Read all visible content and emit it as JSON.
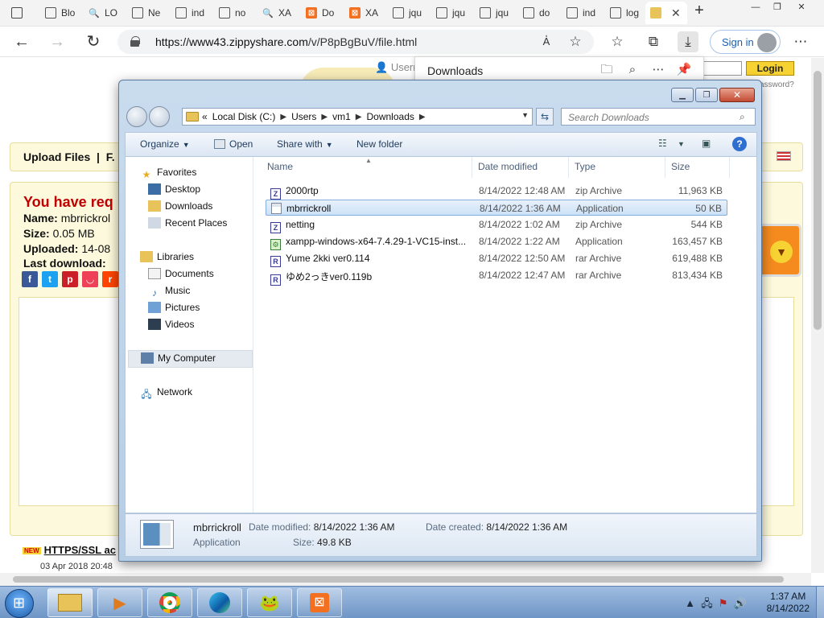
{
  "browser": {
    "tabs": [
      {
        "label": "Blo",
        "icon": "doc-icon"
      },
      {
        "label": "LO",
        "icon": "search-icon"
      },
      {
        "label": "Ne",
        "icon": "news-icon"
      },
      {
        "label": "ind",
        "icon": "doc-icon"
      },
      {
        "label": "no",
        "icon": "doc-icon"
      },
      {
        "label": "XA",
        "icon": "search-icon"
      },
      {
        "label": "Do",
        "icon": "xampp-icon"
      },
      {
        "label": "XA",
        "icon": "xampp-icon"
      },
      {
        "label": "jqu",
        "icon": "doc-icon"
      },
      {
        "label": "jqu",
        "icon": "doc-icon"
      },
      {
        "label": "jqu",
        "icon": "doc-icon"
      },
      {
        "label": "do",
        "icon": "doc-icon"
      },
      {
        "label": "ind",
        "icon": "doc-icon"
      },
      {
        "label": "log",
        "icon": "doc-icon"
      }
    ],
    "url_main": "https://www43.zippyshare.com",
    "url_path": "/v/P8pBgBuV/file.html",
    "signin_label": "Sign in"
  },
  "site": {
    "user_label": "Usern",
    "login_label": "Login",
    "forgot_label": "assword?",
    "upload_label": "Upload Files",
    "nav_partial": "F.",
    "request_title": "You have req",
    "name_label": "Name:",
    "name_value": "mbrrickrol",
    "size_label": "Size:",
    "size_value": "0.05 MB",
    "uploaded_label": "Uploaded:",
    "uploaded_value": "14-08",
    "lastdl_label": "Last download:",
    "ssl_new": "NEW",
    "ssl_link": "HTTPS/SSL ac",
    "ssl_date": "03 Apr 2018 20:48"
  },
  "downloads_panel": {
    "title": "Downloads"
  },
  "explorer": {
    "breadcrumb": [
      "Local Disk (C:)",
      "Users",
      "vm1",
      "Downloads"
    ],
    "breadcrumb_prefix": "«",
    "search_placeholder": "Search Downloads",
    "commands": {
      "organize": "Organize",
      "open": "Open",
      "share_with": "Share with",
      "new_folder": "New folder"
    },
    "nav": {
      "favorites": "Favorites",
      "desktop": "Desktop",
      "downloads": "Downloads",
      "recent": "Recent Places",
      "libraries": "Libraries",
      "documents": "Documents",
      "music": "Music",
      "pictures": "Pictures",
      "videos": "Videos",
      "computer": "My Computer",
      "network": "Network"
    },
    "columns": {
      "name": "Name",
      "date": "Date modified",
      "type": "Type",
      "size": "Size"
    },
    "files": [
      {
        "name": "2000rtp",
        "date": "8/14/2022 12:48 AM",
        "type": "zip Archive",
        "size": "11,963 KB",
        "icon": "zip-icon"
      },
      {
        "name": "mbrrickroll",
        "date": "8/14/2022 1:36 AM",
        "type": "Application",
        "size": "50 KB",
        "icon": "application-icon"
      },
      {
        "name": "netting",
        "date": "8/14/2022 1:02 AM",
        "type": "zip Archive",
        "size": "544 KB",
        "icon": "zip-icon"
      },
      {
        "name": "xampp-windows-x64-7.4.29-1-VC15-inst...",
        "date": "8/14/2022 1:22 AM",
        "type": "Application",
        "size": "163,457 KB",
        "icon": "installer-icon"
      },
      {
        "name": "Yume 2kki ver0.114",
        "date": "8/14/2022 12:50 AM",
        "type": "rar Archive",
        "size": "619,488 KB",
        "icon": "rar-icon"
      },
      {
        "name": "ゆめ2っきver0.119b",
        "date": "8/14/2022 12:47 AM",
        "type": "rar Archive",
        "size": "813,434 KB",
        "icon": "rar-icon"
      }
    ],
    "details": {
      "name": "mbrrickroll",
      "type": "Application",
      "date_modified_label": "Date modified:",
      "date_modified": "8/14/2022 1:36 AM",
      "date_created_label": "Date created:",
      "date_created": "8/14/2022 1:36 AM",
      "size_label": "Size:",
      "size": "49.8 KB"
    }
  },
  "taskbar": {
    "time": "1:37 AM",
    "date": "8/14/2022"
  },
  "colors": {
    "selection": "#cce1f7",
    "zippy_red": "#c00000",
    "zippy_yellow": "#f6d232"
  }
}
